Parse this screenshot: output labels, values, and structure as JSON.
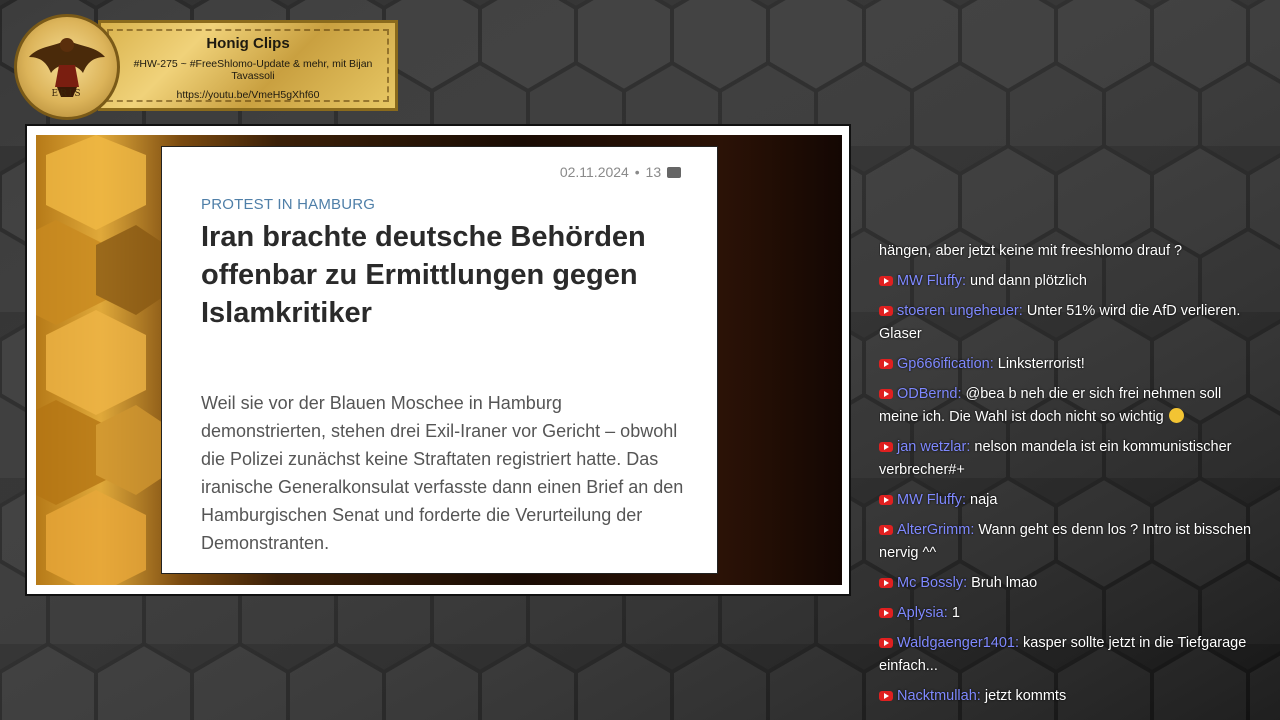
{
  "stream": {
    "title": "Honig Clips",
    "subtitle": "#HW-275 ~ #FreeShlomo-Update & mehr, mit Bijan Tavassoli",
    "url": "https://youtu.be/VmeH5gXhf60",
    "logo_text": "ERIS",
    "logo_icon": "eris-crest-icon"
  },
  "article": {
    "date": "02.11.2024",
    "comment_count": "13",
    "kicker": "PROTEST IN HAMBURG",
    "headline": "Iran brachte deutsche Behörden offenbar zu Ermittlungen gegen Islamkritiker",
    "lead": "Weil sie vor der Blauen Moschee in Hamburg demonstrierten, stehen drei Exil-Iraner vor Gericht – obwohl die Polizei zunächst keine Straftaten registriert hatte. Das iranische Generalkonsulat verfasste dann einen Brief an den Hamburgischen Senat und forderte die Verurteilung der Demonstranten."
  },
  "chat": {
    "partial_first": "hängen, aber jetzt keine mit freeshlomo drauf ?",
    "messages": [
      {
        "author": "MW Fluffy",
        "text": "und dann plötzlich"
      },
      {
        "author": "stoeren ungeheuer",
        "text": "Unter 51% wird die AfD verlieren. Glaser"
      },
      {
        "author": "Gp666ification",
        "text": "Linksterrorist!"
      },
      {
        "author": "ODBernd",
        "text": "@bea b neh die er sich frei nehmen soll meine ich. Die Wahl ist doch nicht so wichtig"
      },
      {
        "author": "jan wetzlar",
        "text": "nelson mandela ist ein kommunistischer verbrecher#+"
      },
      {
        "author": "MW Fluffy",
        "text": "naja"
      },
      {
        "author": "AlterGrimm",
        "text": "Wann geht es denn los ? Intro ist bisschen nervig ^^"
      },
      {
        "author": "Mc Bossly",
        "text": "Bruh lmao"
      },
      {
        "author": "Aplysia",
        "text": "1"
      },
      {
        "author": "Waldgaenger1401",
        "text": "kasper sollte jetzt in die Tiefgarage einfach..."
      },
      {
        "author": "Nacktmullah",
        "text": "jetzt kommts"
      }
    ]
  },
  "colors": {
    "author": "#7f89ff",
    "kicker": "#4f7fa8",
    "youtube_badge": "#e02020",
    "banner_gold": "#d9b24c"
  }
}
